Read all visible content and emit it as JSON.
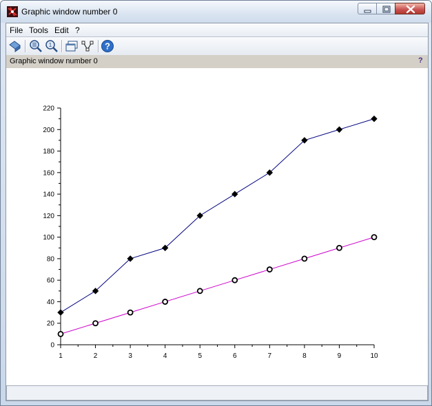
{
  "window": {
    "title": "Graphic window number 0"
  },
  "menubar": {
    "items": [
      {
        "label": "File"
      },
      {
        "label": "Tools"
      },
      {
        "label": "Edit"
      },
      {
        "label": "?"
      }
    ]
  },
  "toolbar": {
    "buttons": [
      {
        "icon": "rotate-icon"
      },
      {
        "icon": "zoom-icon"
      },
      {
        "icon": "unzoom-icon"
      },
      {
        "icon": "new-window-icon"
      },
      {
        "icon": "datatip-icon"
      },
      {
        "icon": "help-icon"
      }
    ]
  },
  "infobar": {
    "text": "Graphic window number 0",
    "help": "?"
  },
  "colors": {
    "series_1": "#00007f",
    "series_2": "#cc00cc",
    "infobar": "#d4d0c8"
  },
  "chart_data": {
    "type": "line",
    "x": [
      1,
      2,
      3,
      4,
      5,
      6,
      7,
      8,
      9,
      10
    ],
    "xlim": [
      1,
      10
    ],
    "ylim": [
      0,
      220
    ],
    "xticks": [
      1,
      2,
      3,
      4,
      5,
      6,
      7,
      8,
      9,
      10
    ],
    "yticks": [
      0,
      20,
      40,
      60,
      80,
      100,
      120,
      140,
      160,
      180,
      200,
      220
    ],
    "grid": false,
    "series": [
      {
        "values": [
          30,
          50,
          80,
          90,
          120,
          140,
          160,
          190,
          200,
          210
        ],
        "color": "#00007f",
        "marker": "diamond"
      },
      {
        "values": [
          10,
          20,
          30,
          40,
          50,
          60,
          70,
          80,
          90,
          100
        ],
        "color": "#cc00cc",
        "marker": "circle"
      }
    ]
  }
}
